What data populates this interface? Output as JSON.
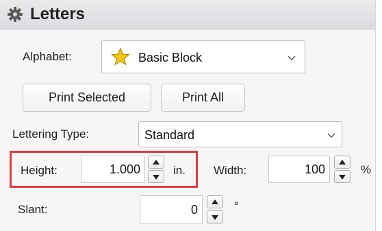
{
  "panel": {
    "title": "Letters",
    "icon": "gear-icon"
  },
  "alphabet": {
    "label": "Alphabet:",
    "value": "Basic Block",
    "icon": "star-icon",
    "icon_color": "#f3c51a"
  },
  "buttons": {
    "print_selected": "Print Selected",
    "print_all": "Print All"
  },
  "lettering_type": {
    "label": "Lettering Type:",
    "value": "Standard"
  },
  "height": {
    "label": "Height:",
    "value": "1.000",
    "unit": "in."
  },
  "width": {
    "label": "Width:",
    "value": "100",
    "unit": "%"
  },
  "slant": {
    "label": "Slant:",
    "value": "0",
    "unit": "°"
  },
  "colors": {
    "highlight": "#e23b3b",
    "header_bg": "#dcdde0"
  }
}
